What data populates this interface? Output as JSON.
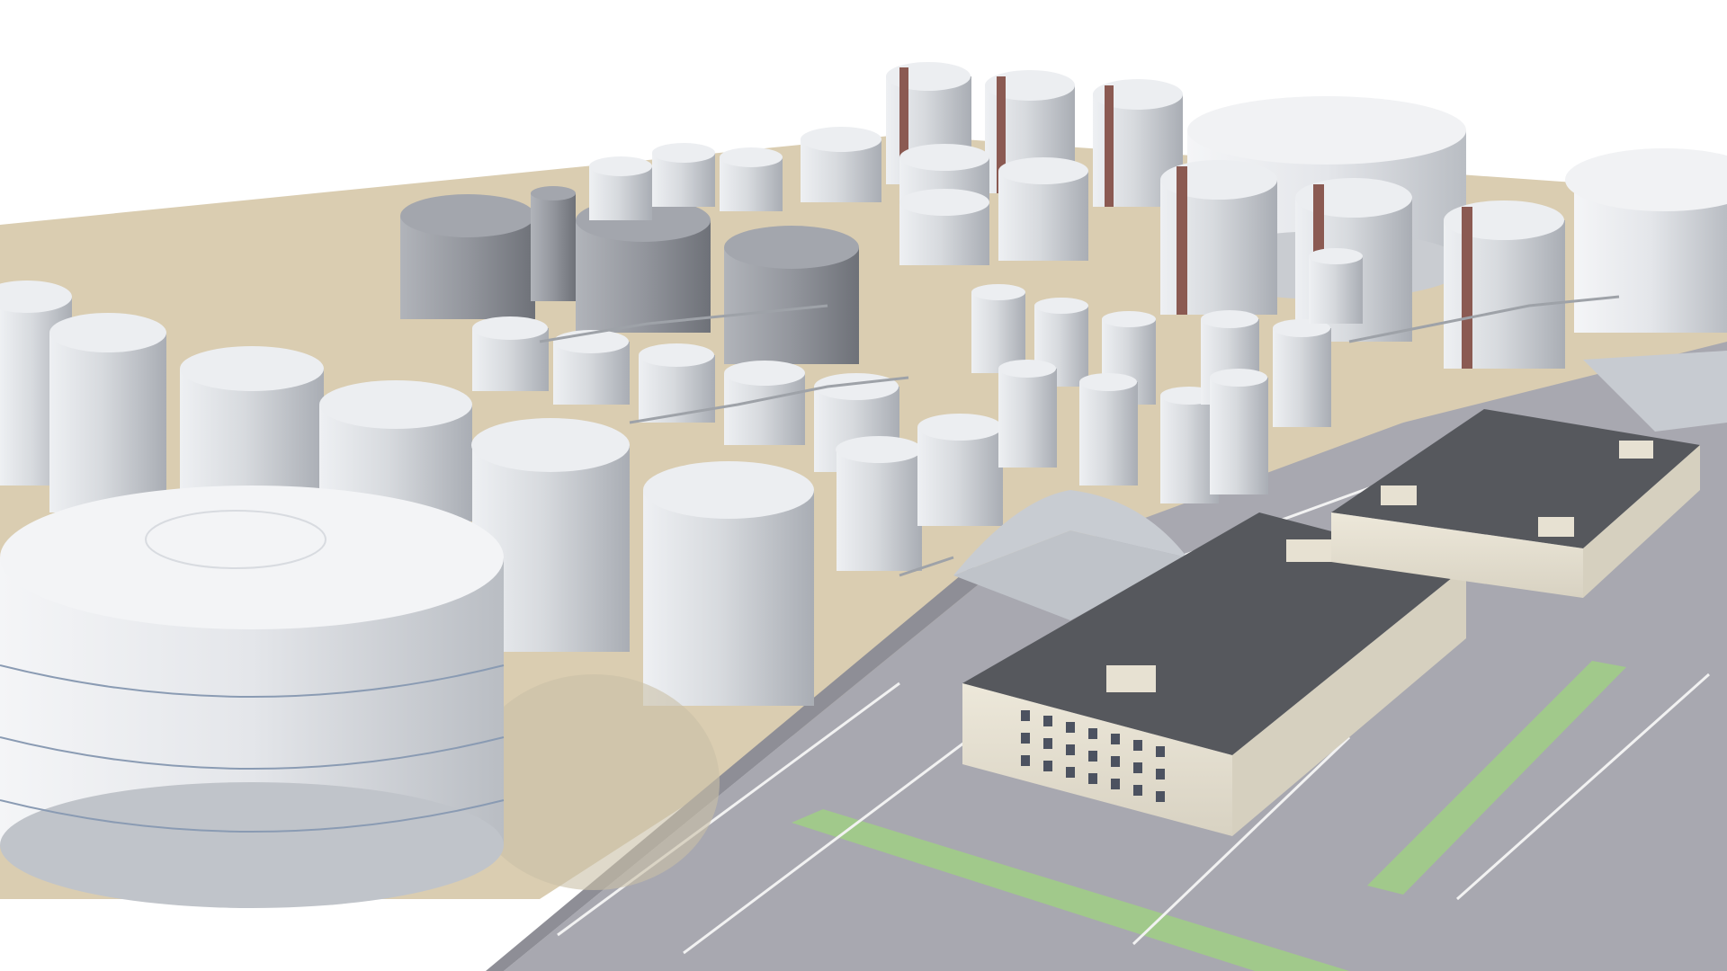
{
  "scene": {
    "subject": "oil-storage-tank-farm-3d-render",
    "colors": {
      "background": "#ffffff",
      "ground_sand": "#d9ccb0",
      "asphalt": "#a6a6ad",
      "tank_body": "#d3d6dc",
      "tank_roof": "#e7e9ec",
      "dark_tank": "#8c8f96",
      "grass": "#9fc48a",
      "roof_dark": "#57595e",
      "building_wall": "#e7e1d2"
    }
  }
}
